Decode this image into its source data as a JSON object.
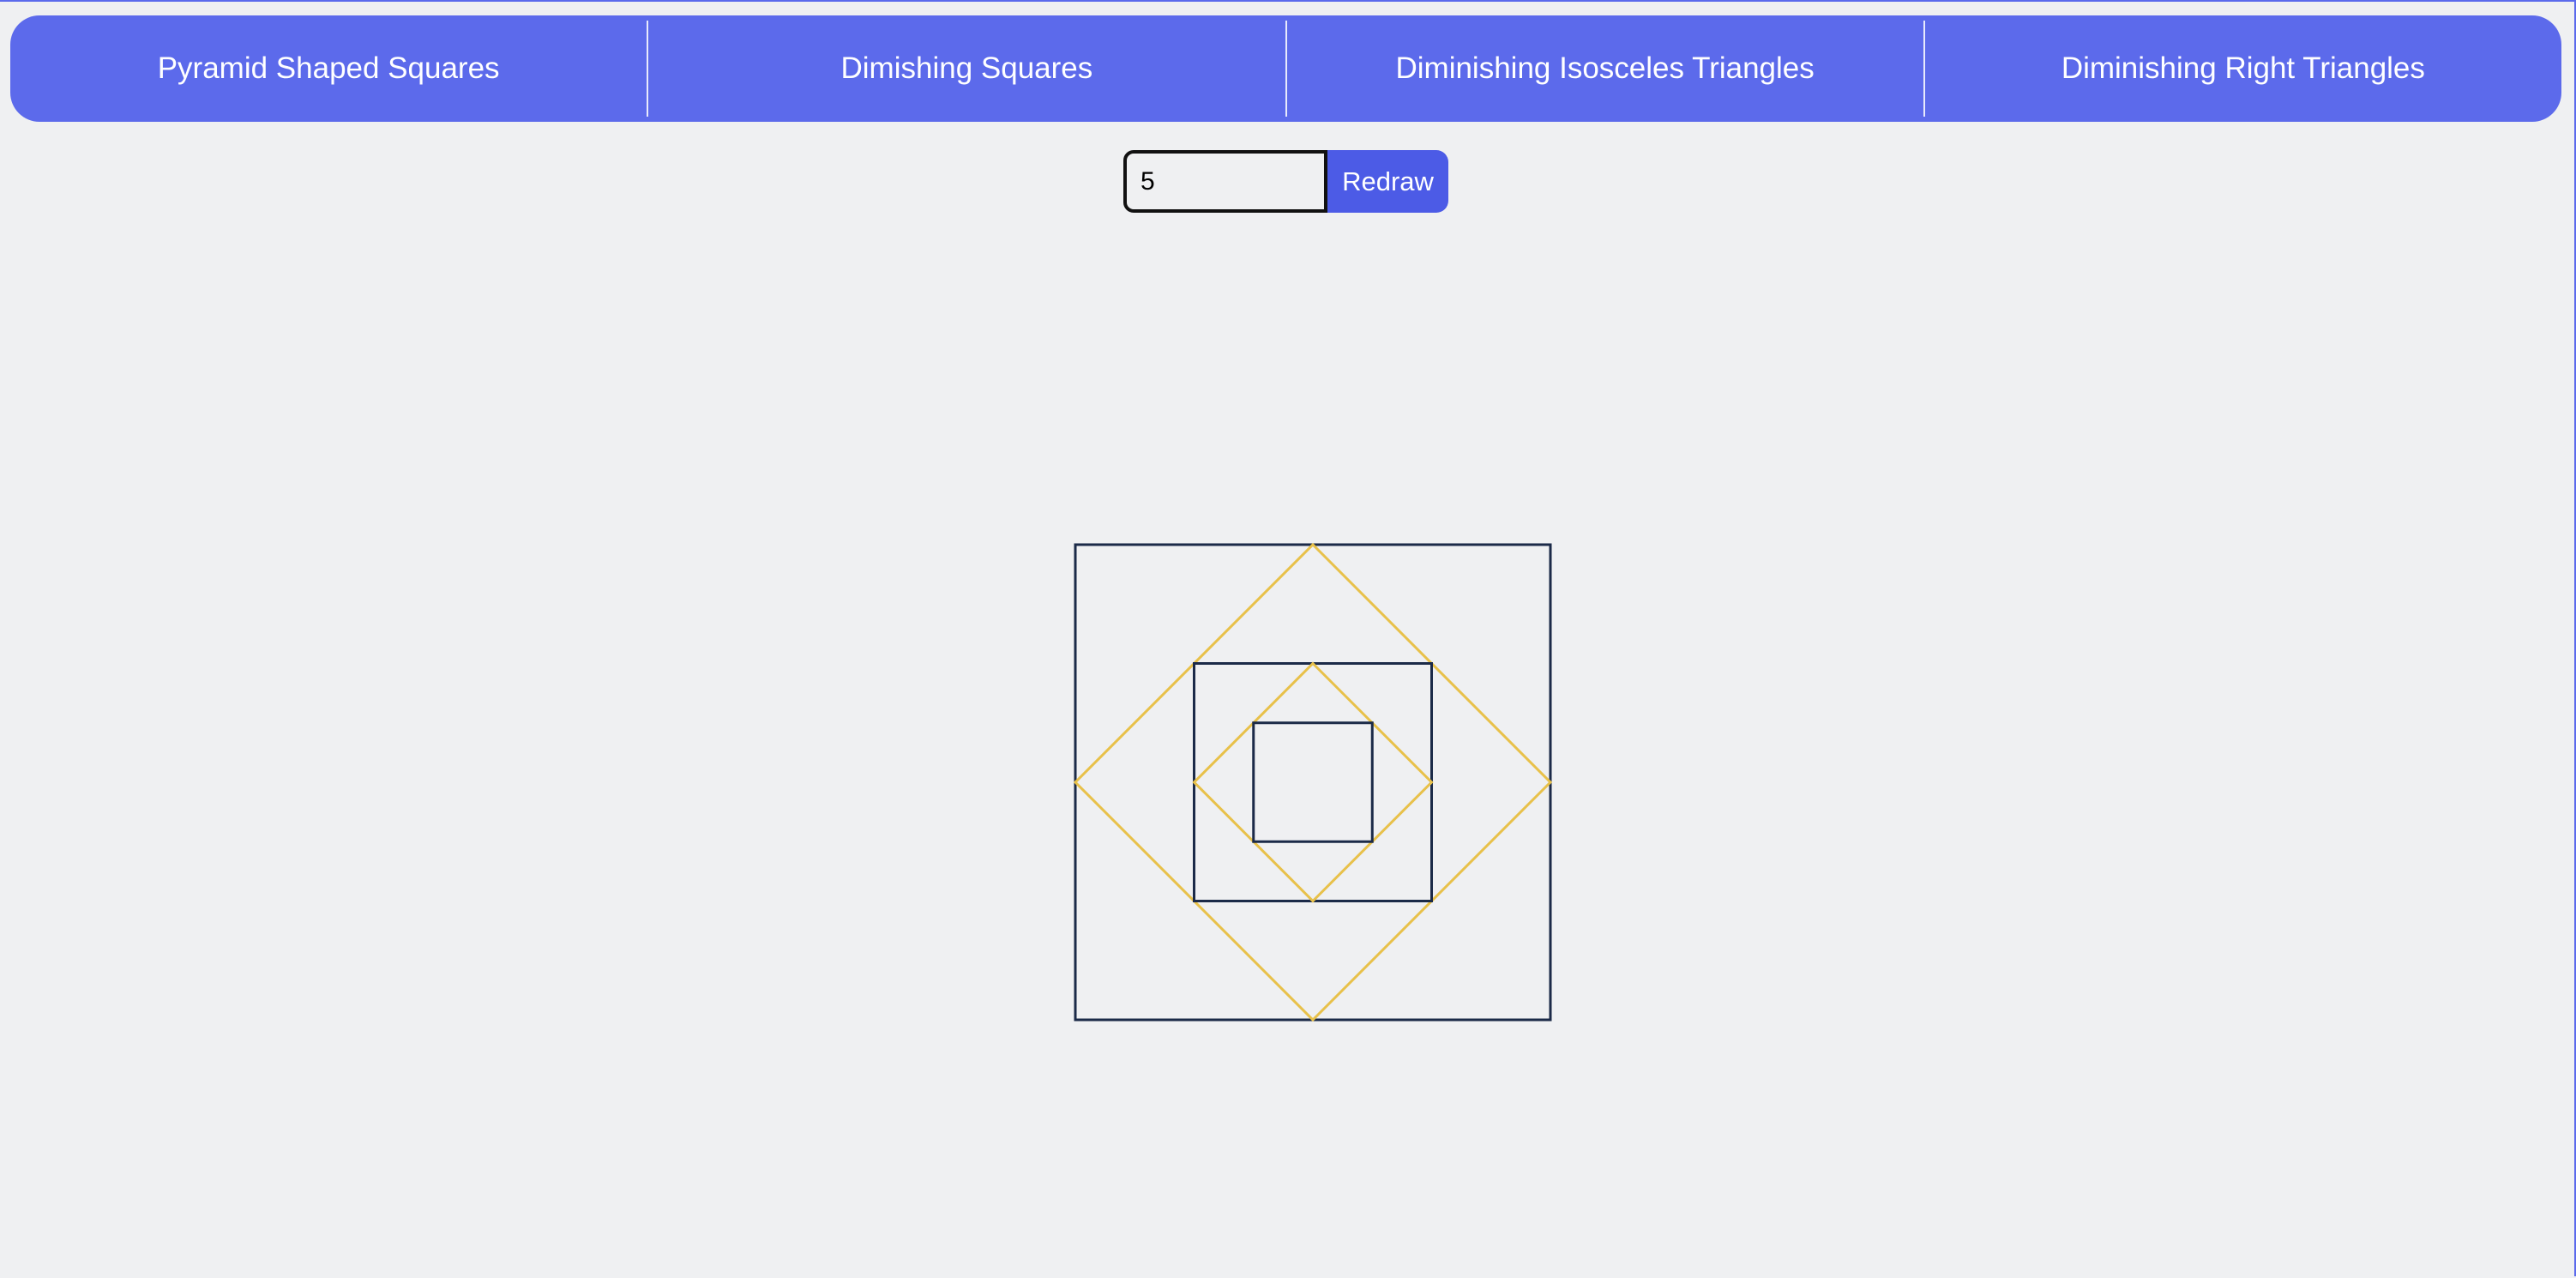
{
  "nav": {
    "items": [
      {
        "label": "Pyramid Shaped Squares"
      },
      {
        "label": "Dimishing Squares"
      },
      {
        "label": "Diminishing Isosceles Triangles"
      },
      {
        "label": "Diminishing Right Triangles"
      }
    ]
  },
  "controls": {
    "count_value": "5",
    "redraw_label": "Redraw"
  },
  "drawing": {
    "shape_count": 5,
    "colors": {
      "square_stroke": "#1b2a48",
      "diamond_stroke": "#e8c14a",
      "background": "#eff0f2",
      "nav_background": "#5c6aeb",
      "button_background": "#4c5be6"
    }
  }
}
